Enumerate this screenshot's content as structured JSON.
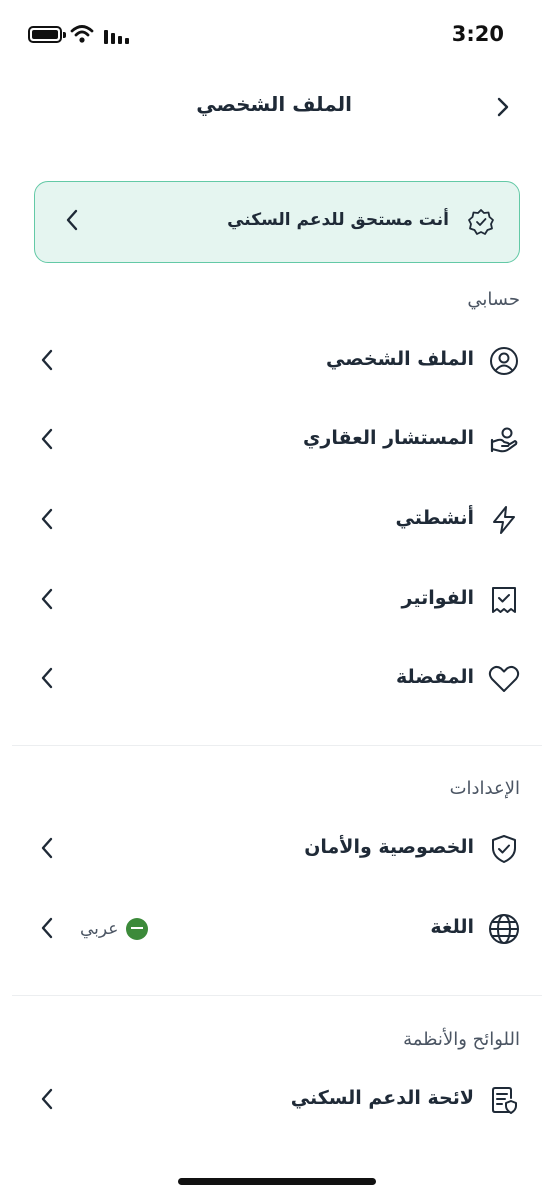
{
  "status_bar": {
    "time": "3:20"
  },
  "header": {
    "title": "الملف الشخصي"
  },
  "eligibility_card": {
    "text": "أنت مستحق للدعم السكني"
  },
  "sections": {
    "account": {
      "heading": "حسابي",
      "items": [
        {
          "label": "الملف الشخصي",
          "icon": "user-circle-icon"
        },
        {
          "label": "المستشار العقاري",
          "icon": "advisor-hand-icon"
        },
        {
          "label": "أنشطتي",
          "icon": "lightning-icon"
        },
        {
          "label": "الفواتير",
          "icon": "receipt-check-icon"
        },
        {
          "label": "المفضلة",
          "icon": "heart-icon"
        }
      ]
    },
    "settings": {
      "heading": "الإعدادات",
      "items": [
        {
          "label": "الخصوصية والأمان",
          "icon": "shield-check-icon"
        },
        {
          "label": "اللغة",
          "icon": "globe-icon",
          "value": "عربي"
        }
      ]
    },
    "regulations": {
      "heading": "اللوائح والأنظمة",
      "items": [
        {
          "label": "لائحة الدعم السكني",
          "icon": "document-shield-icon"
        }
      ]
    }
  }
}
